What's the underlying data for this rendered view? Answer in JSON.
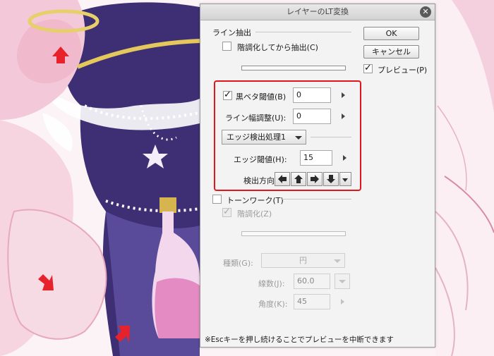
{
  "dialog": {
    "title": "レイヤーのLT変換",
    "close_glyph": "✕",
    "ok_label": "OK",
    "cancel_label": "キャンセル",
    "preview_label": "プレビュー(P)",
    "preview_checked": true
  },
  "line_extract": {
    "header": "ライン抽出",
    "gradation_label": "階調化してから抽出(C)",
    "gradation_checked": false,
    "black_threshold_label": "黒ベタ閾値(B)",
    "black_threshold_checked": true,
    "black_threshold_value": "0",
    "line_width_label": "ライン幅調整(U):",
    "line_width_value": "0",
    "edge_process_selected": "エッジ検出処理1",
    "edge_threshold_label": "エッジ閾値(H):",
    "edge_threshold_value": "15",
    "direction_label": "検出方向"
  },
  "tone_work": {
    "header": "トーンワーク(T)",
    "header_checked": false,
    "gradation_label": "階調化(Z)",
    "gradation_checked": true,
    "type_label": "種類(G):",
    "type_value": "円",
    "lines_label": "線数(J):",
    "lines_value": "60.0",
    "angle_label": "角度(K):",
    "angle_value": "45"
  },
  "footer_note": "※Escキーを押し続けることでプレビューを中断できます",
  "colors": {
    "highlight": "#e0161e",
    "annotation_arrow": "#e8222a"
  },
  "icons": {
    "close": "close-icon",
    "check": "checkmark-icon",
    "arrows": [
      "arrow-left-icon",
      "arrow-up-icon",
      "arrow-right-icon",
      "arrow-down-icon"
    ]
  }
}
